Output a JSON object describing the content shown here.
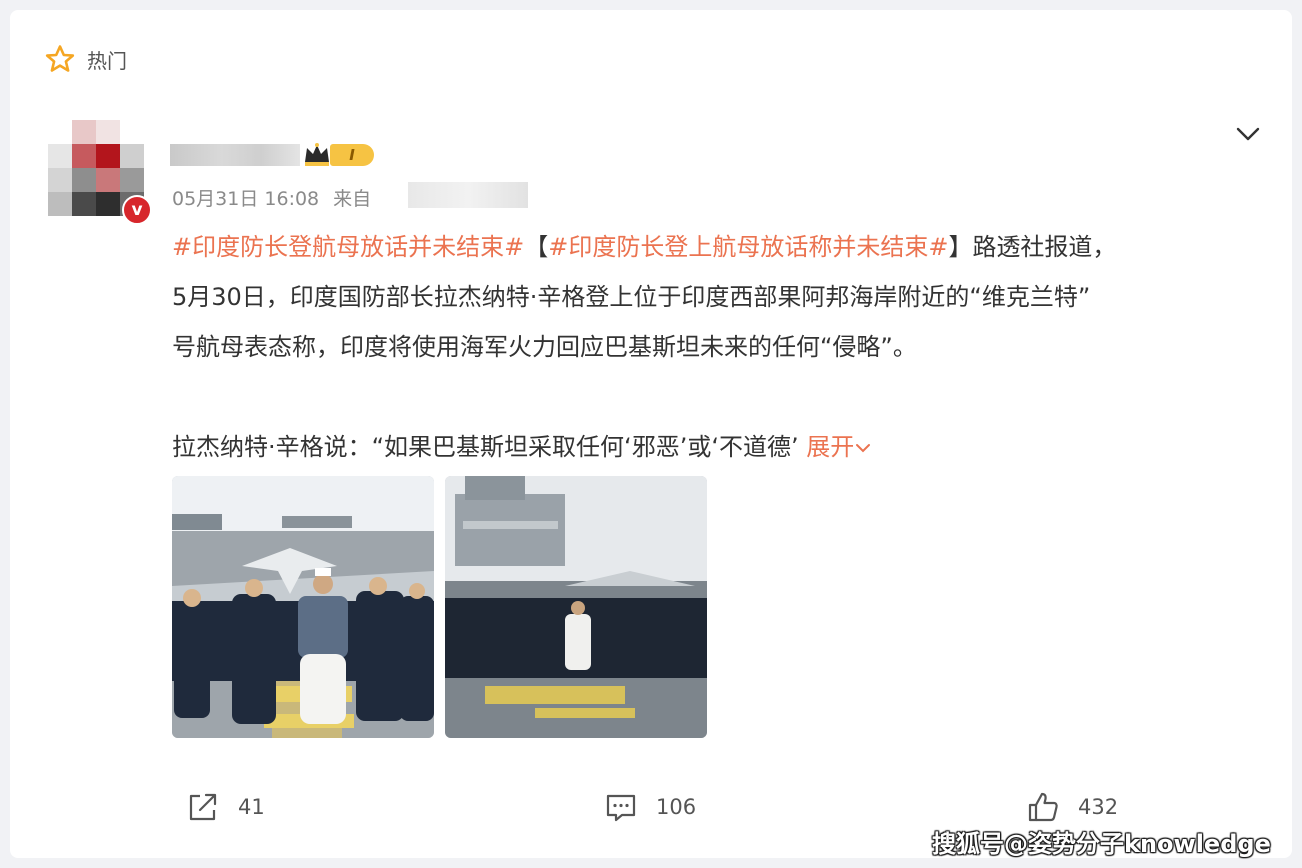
{
  "header": {
    "hot_label": "热门"
  },
  "post": {
    "level_badge": "I",
    "date": "05月31日 16:08",
    "from_label": "来自",
    "hashtag1": "#印度防长登航母放话并未结束#",
    "bracket_open": "【",
    "hashtag2": "#印度防长登上航母放话称并未结束#",
    "bracket_close": "】",
    "line1_tail": "路透社报道，",
    "line2": "5月30日，印度国防部长拉杰纳特·辛格登上位于印度西部果阿邦海岸附近的“维克兰特”",
    "line3": "号航母表态称，印度将使用海军火力回应巴基斯坦未来的任何“侵略”。",
    "line4": "拉杰纳特·辛格说：“如果巴基斯坦采取任何‘邪恶’或‘不道德’",
    "expand_label": "展开"
  },
  "actions": {
    "repost_count": "41",
    "comment_count": "106",
    "like_count": "432"
  },
  "watermark": "搜狐号@姿势分子knowledge",
  "colors": {
    "accent": "#eb7350",
    "verified": "#d7262b",
    "star": "#f5a623"
  },
  "icons": [
    "star-icon",
    "crown-icon",
    "chevron-down-icon",
    "repost-icon",
    "comment-icon",
    "like-icon"
  ]
}
